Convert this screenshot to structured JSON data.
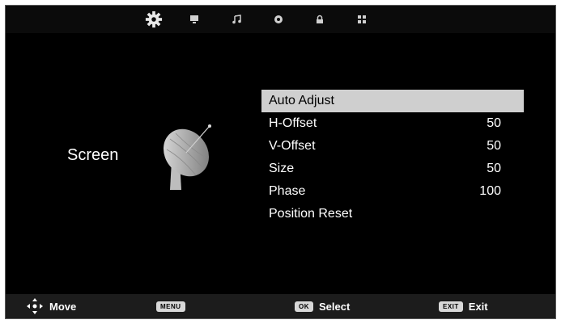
{
  "tabs": [
    {
      "icon": "gear-icon",
      "active": true
    },
    {
      "icon": "monitor-icon",
      "active": false
    },
    {
      "icon": "music-note-icon",
      "active": false
    },
    {
      "icon": "clock-icon",
      "active": false
    },
    {
      "icon": "lock-icon",
      "active": false
    },
    {
      "icon": "grid-icon",
      "active": false
    }
  ],
  "section": {
    "title": "Screen",
    "icon": "satellite-dish-icon"
  },
  "menu": {
    "items": [
      {
        "label": "Auto Adjust",
        "value": "",
        "selected": true
      },
      {
        "label": "H-Offset",
        "value": "50",
        "selected": false
      },
      {
        "label": "V-Offset",
        "value": "50",
        "selected": false
      },
      {
        "label": "Size",
        "value": "50",
        "selected": false
      },
      {
        "label": "Phase",
        "value": "100",
        "selected": false
      },
      {
        "label": "Position Reset",
        "value": "",
        "selected": false
      }
    ]
  },
  "footer": {
    "move_label": "Move",
    "menu_key": "MENU",
    "ok_key": "OK",
    "select_label": "Select",
    "exit_key": "EXIT",
    "exit_label": "Exit"
  },
  "colors": {
    "background": "#000000",
    "highlight": "#cfcfcf",
    "text": "#ffffff"
  }
}
